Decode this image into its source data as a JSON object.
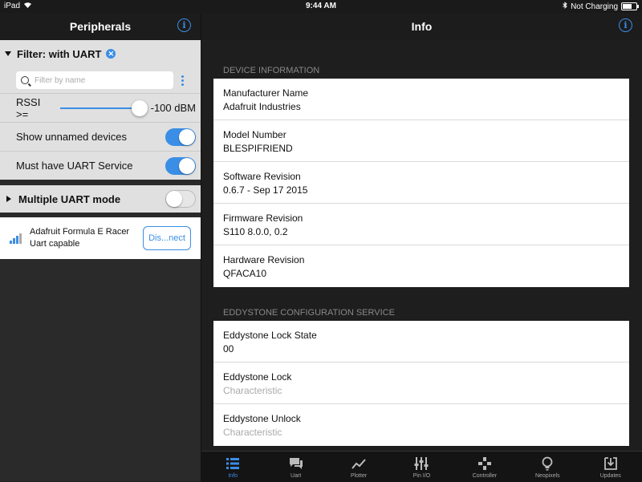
{
  "status_bar": {
    "device": "iPad",
    "time": "9:44 AM",
    "battery_status": "Not Charging"
  },
  "left_panel": {
    "title": "Peripherals",
    "filter": {
      "title": "Filter: with UART",
      "search_placeholder": "Filter by name",
      "rssi_label": "RSSI >=",
      "rssi_value": "-100 dBM",
      "show_unnamed_label": "Show unnamed devices",
      "show_unnamed_on": true,
      "must_have_uart_label": "Must have UART Service",
      "must_have_uart_on": true
    },
    "multiple_uart": {
      "label": "Multiple UART mode",
      "on": false
    },
    "devices": [
      {
        "name": "Adafruit Formula E Racer",
        "subtitle": "Uart capable",
        "action": "Dis...nect"
      }
    ]
  },
  "right_panel": {
    "title": "Info",
    "sections": [
      {
        "header": "DEVICE INFORMATION",
        "rows": [
          {
            "label": "Manufacturer Name",
            "value": "Adafruit Industries"
          },
          {
            "label": "Model Number",
            "value": "BLESPIFRIEND"
          },
          {
            "label": "Software Revision",
            "value": "0.6.7 - Sep 17 2015"
          },
          {
            "label": "Firmware Revision",
            "value": "S110 8.0.0, 0.2"
          },
          {
            "label": "Hardware Revision",
            "value": "QFACA10"
          }
        ]
      },
      {
        "header": "EDDYSTONE CONFIGURATION SERVICE",
        "rows": [
          {
            "label": "Eddystone Lock State",
            "value": "00"
          },
          {
            "label": "Eddystone Lock",
            "value": "Characteristic"
          },
          {
            "label": "Eddystone Unlock",
            "value": "Characteristic"
          }
        ]
      }
    ]
  },
  "tabs": [
    {
      "label": "Info",
      "icon": "list-icon",
      "active": true
    },
    {
      "label": "Uart",
      "icon": "chat-icon",
      "active": false
    },
    {
      "label": "Plotter",
      "icon": "line-chart-icon",
      "active": false
    },
    {
      "label": "Pin I/O",
      "icon": "pins-icon",
      "active": false
    },
    {
      "label": "Controller",
      "icon": "gamepad-icon",
      "active": false
    },
    {
      "label": "Neopixels",
      "icon": "lightbulb-icon",
      "active": false
    },
    {
      "label": "Updates",
      "icon": "download-icon",
      "active": false
    }
  ],
  "colors": {
    "accent": "#3a8ee6"
  }
}
